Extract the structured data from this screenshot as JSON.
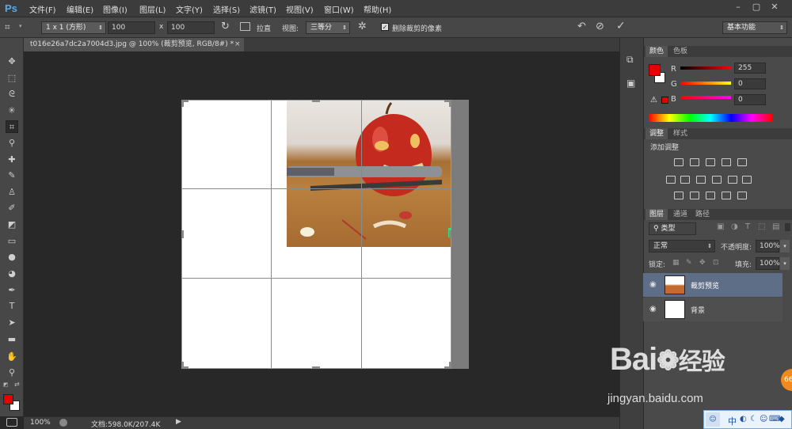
{
  "app": {
    "logo": "Ps"
  },
  "menus": [
    "文件(F)",
    "编辑(E)",
    "图像(I)",
    "图层(L)",
    "文字(Y)",
    "选择(S)",
    "滤镜(T)",
    "视图(V)",
    "窗口(W)",
    "帮助(H)"
  ],
  "window_controls": [
    "–",
    "▢",
    "✕"
  ],
  "options": {
    "ratio": "1 x 1 (方形)",
    "width": "100",
    "x": "x",
    "height": "100",
    "straighten": "拉直",
    "view_label": "视图:",
    "view_value": "三等分",
    "delete_cropped": "删除裁剪的像素",
    "delete_cropped_checked": true,
    "workspace": "基本功能"
  },
  "document": {
    "tab_title": "t016e26a7dc2a7004d3.jpg @ 100% (裁剪预览, RGB/8#) *",
    "tab_close": "×"
  },
  "status": {
    "zoom": "100%",
    "doc_info": "文档:598.0K/207.4K"
  },
  "color_panel": {
    "tabs": [
      "颜色",
      "色板"
    ],
    "channels": [
      {
        "name": "R",
        "value": "255"
      },
      {
        "name": "G",
        "value": "0"
      },
      {
        "name": "B",
        "value": "0"
      }
    ],
    "foreground": "#e60000"
  },
  "adjust_panel": {
    "tabs": [
      "调整",
      "样式"
    ],
    "title": "添加调整"
  },
  "layers_panel": {
    "tabs": [
      "图层",
      "通道",
      "路径"
    ],
    "filter": "类型",
    "blend": "正常",
    "opacity_label": "不透明度:",
    "opacity": "100%",
    "lock_label": "锁定:",
    "fill_label": "填充:",
    "fill": "100%",
    "layers": [
      {
        "name": "裁剪预览",
        "selected": true
      },
      {
        "name": "背景",
        "selected": false
      }
    ]
  },
  "watermark": {
    "brand": "Bai",
    "brand2": "经验",
    "url": "jingyan.baidu.com"
  },
  "badge": "66",
  "ime": [
    "中",
    "◐",
    "☾",
    "☺",
    "⌨",
    "◆",
    "▤",
    "⬛"
  ]
}
